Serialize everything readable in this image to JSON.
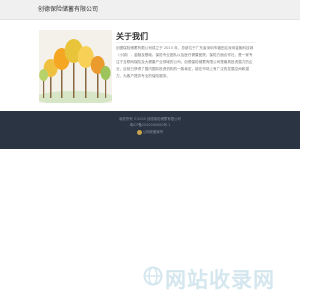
{
  "header": {
    "company_name": "创德保险储蓄有限公司"
  },
  "about": {
    "title": "关于我们",
    "body": "创德保险储蓄有限公司成立于 2015 年，总部位于广东省深圳市福田区深圳金融科技城（小镇），金融及基础。保险专业团队以及医疗健康医院，保险方面合作社，是一家专注于互联网保险及大健康产业领域的公司，创德保险储蓄有限公司是最具投资潜力的企业，目前已获得了国内国际投资机构的一致肯定，能在市场上有广泛的发展空间和潜力，为客户提供专业的保险服务。"
  },
  "footer": {
    "line1": "版权所有 ©2020 创德保险储蓄有限公司",
    "line2": "粤ICP备2020000000号-1",
    "line3": "公网安备案号"
  },
  "watermark": {
    "text": "网站收录网",
    "icon": "globe-icon"
  },
  "colors": {
    "header_bg": "#f0f0f0",
    "footer_bg": "#2b3442",
    "watermark": "#d5e7ee"
  }
}
